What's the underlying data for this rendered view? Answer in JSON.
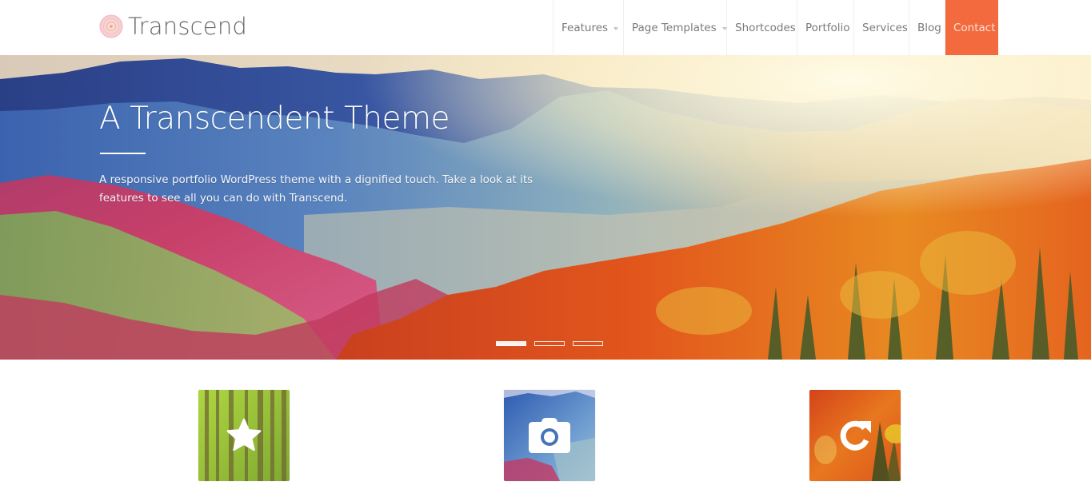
{
  "site": {
    "name": "Transcend",
    "logo_icon": "concentric-circles-logo-icon",
    "accent_color": "#f26a3d"
  },
  "nav": {
    "items": [
      {
        "label": "Features",
        "has_dropdown": true
      },
      {
        "label": "Page Templates",
        "has_dropdown": true
      },
      {
        "label": "Shortcodes",
        "has_dropdown": false
      },
      {
        "label": "Portfolio",
        "has_dropdown": false
      },
      {
        "label": "Services",
        "has_dropdown": false
      },
      {
        "label": "Blog",
        "has_dropdown": false
      },
      {
        "label": "Contact",
        "has_dropdown": false,
        "highlighted": true
      }
    ]
  },
  "hero": {
    "title": "A Transcendent Theme",
    "description": "A responsive portfolio WordPress theme with a dignified touch. Take a look at its features to see all you can do with Transcend.",
    "background": "autumn-mountain-landscape",
    "slides": [
      {
        "index": 1,
        "active": true
      },
      {
        "index": 2,
        "active": false
      },
      {
        "index": 3,
        "active": false
      }
    ]
  },
  "features": [
    {
      "icon": "star-icon",
      "background": "green-forest"
    },
    {
      "icon": "camera-icon",
      "background": "blue-mountains"
    },
    {
      "icon": "refresh-icon",
      "background": "orange-autumn-trees"
    }
  ]
}
